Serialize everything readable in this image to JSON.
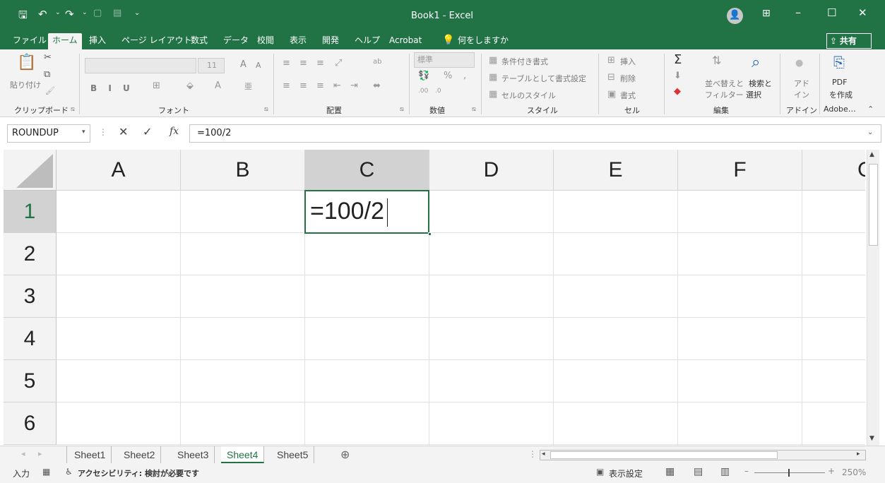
{
  "title": {
    "app": "Book1 - Excel"
  },
  "tabs": [
    "ファイル",
    "ホーム",
    "挿入",
    "ページ レイアウト",
    "数式",
    "データ",
    "校閲",
    "表示",
    "開発",
    "ヘルプ",
    "Acrobat"
  ],
  "search": "何をしますか",
  "share": "共有",
  "ribbon": {
    "paste": "貼り付け",
    "clipboard": "クリップボード",
    "font": "フォント",
    "font_size": "11",
    "font_letters": "B  I  U",
    "align": "配置",
    "number": "数値",
    "number_format": "標準",
    "style1": "条件付き書式",
    "style2": "テーブルとして書式設定",
    "style3": "セルのスタイル",
    "styles": "スタイル",
    "insert": "挿入",
    "delete": "削除",
    "format": "書式",
    "cells": "セル",
    "sort": "並べ替えと",
    "filter": "フィルター",
    "find": "検索と",
    "select": "選択",
    "editing": "編集",
    "addin1": "アド",
    "addin2": "イン",
    "addin": "アドイン",
    "pdf": "PDF",
    "pdf2": "を作成",
    "adobe": "Adobe…"
  },
  "formula": {
    "name_box": "ROUNDUP",
    "content": "=100/2"
  },
  "columns": [
    "A",
    "B",
    "C",
    "D",
    "E",
    "F",
    "G"
  ],
  "rows": [
    "1",
    "2",
    "3",
    "4",
    "5",
    "6"
  ],
  "active_cell_text": "=100/2",
  "sheets": [
    "Sheet1",
    "Sheet2",
    "Sheet3",
    "Sheet4",
    "Sheet5"
  ],
  "status": {
    "mode": "入力",
    "accessibility": "アクセシビリティ: 検討が必要です",
    "display": "表示設定",
    "zoom": "250%"
  },
  "colors": {
    "accent": "#217346"
  }
}
